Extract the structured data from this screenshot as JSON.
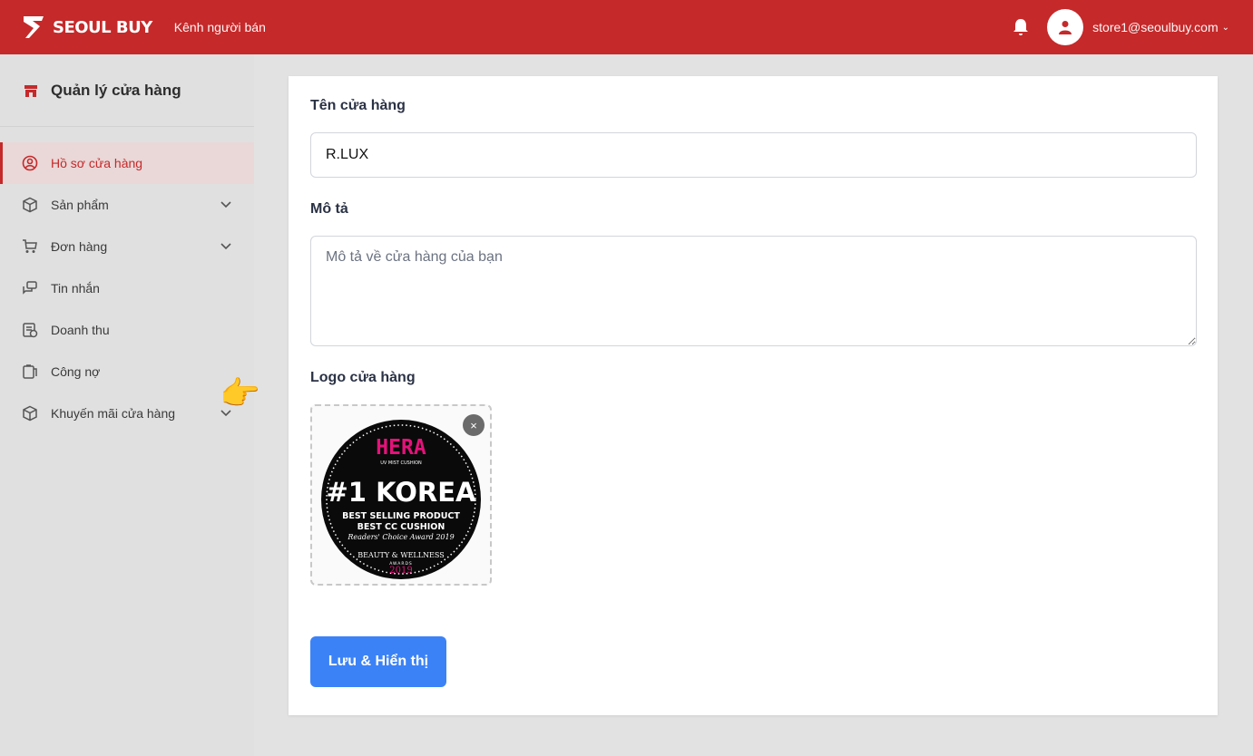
{
  "header": {
    "brand_name": "SEOUL BUY",
    "brand_sub": "Kênh người bán",
    "user_email": "store1@seoulbuy.com",
    "icons": [
      "seoulbuy-logo",
      "bell-icon",
      "user-icon",
      "chevron-down-icon"
    ],
    "accent_color": "#c5292a"
  },
  "sidebar": {
    "title": "Quản lý cửa hàng",
    "items": [
      {
        "label": "Hồ sơ cửa hàng",
        "icon": "store-profile-icon",
        "active": true
      },
      {
        "label": "Sản phẩm",
        "icon": "product-icon",
        "expandable": true
      },
      {
        "label": "Đơn hàng",
        "icon": "cart-icon",
        "expandable": true
      },
      {
        "label": "Tin nhắn",
        "icon": "message-icon"
      },
      {
        "label": "Doanh thu",
        "icon": "revenue-icon"
      },
      {
        "label": "Công nợ",
        "icon": "debt-icon"
      },
      {
        "label": "Khuyến mãi cửa hàng",
        "icon": "promotion-icon",
        "expandable": true
      }
    ]
  },
  "form": {
    "name_label": "Tên cửa hàng",
    "name_value": "R.LUX",
    "desc_label": "Mô tả",
    "desc_placeholder": "Mô tả về cửa hàng của bạn",
    "logo_label": "Logo cửa hàng",
    "logo": {
      "brand": "HERA",
      "brand_sub": "UV MIST CUSHION",
      "headline": "#1 KOREA",
      "line1": "BEST SELLING PRODUCT",
      "line2": "BEST CC CUSHION",
      "line3": "Readers' Choice Award 2019",
      "line4": "BEAUTY & WELLNESS",
      "line5": "AWARDS",
      "year": "2019"
    },
    "remove_label": "×",
    "save_label": "Lưu & Hiển thị"
  }
}
